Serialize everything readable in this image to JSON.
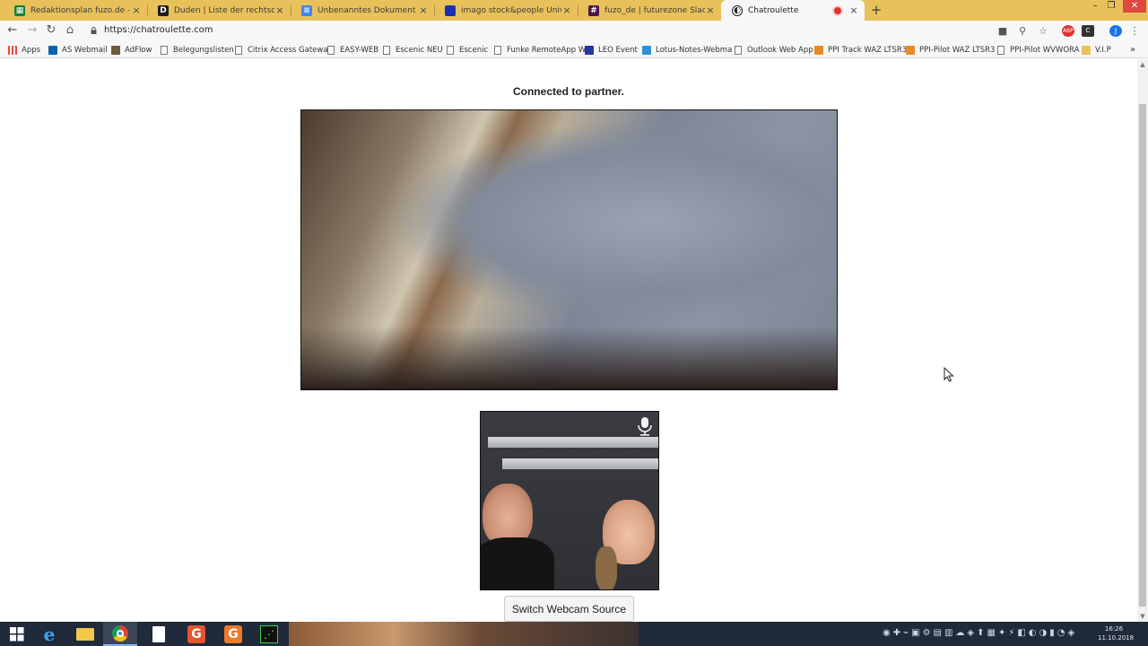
{
  "browser": {
    "tabs": [
      {
        "title": "Redaktionsplan fuzo.de - Google",
        "favicon": "sheets-icon",
        "color": "#188038"
      },
      {
        "title": "Duden | Liste der rechtschreiblich",
        "favicon": "duden-icon",
        "color": "#1b1b1b",
        "glyph": "D"
      },
      {
        "title": "Unbenanntes Dokument - Google",
        "favicon": "docs-icon",
        "color": "#4285f4"
      },
      {
        "title": "imago stock&people Universalfo",
        "favicon": "imago-icon",
        "color": "#1a2fb5"
      },
      {
        "title": "fuzo_de | futurezone Slack",
        "favicon": "slack-icon",
        "color": "#4a154b",
        "glyph": "#"
      },
      {
        "title": "Chatroulette",
        "favicon": "chatroulette-icon",
        "color": "#222222",
        "active": true,
        "recording": true
      }
    ],
    "url": "https://chatroulette.com",
    "bookmarks": [
      {
        "label": "Apps",
        "icon": "apps-grid-icon",
        "color": "#e8453c"
      },
      {
        "label": "AS Webmail",
        "icon": "outlook-icon",
        "color": "#0a64ad"
      },
      {
        "label": "AdFlow",
        "icon": "adflow-icon",
        "color": "#6b5b3a"
      },
      {
        "label": "Belegungslisten",
        "icon": "page-icon"
      },
      {
        "label": "Citrix Access Gatewa",
        "icon": "page-icon"
      },
      {
        "label": "EASY-WEB",
        "icon": "page-icon"
      },
      {
        "label": "Escenic NEU",
        "icon": "page-icon"
      },
      {
        "label": "Escenic",
        "icon": "page-icon"
      },
      {
        "label": "Funke RemoteApp W",
        "icon": "page-icon"
      },
      {
        "label": "LEO Event",
        "icon": "leo-icon",
        "color": "#2335a8"
      },
      {
        "label": "Lotus-Notes-Webma",
        "icon": "lotus-icon",
        "color": "#2f8fd1"
      },
      {
        "label": "Outlook Web App",
        "icon": "page-icon"
      },
      {
        "label": "PPI Track WAZ LTSR3",
        "icon": "ppi-icon",
        "color": "#e88a28"
      },
      {
        "label": "PPI-Pilot WAZ LTSR3",
        "icon": "ppi-icon",
        "color": "#e88a28"
      },
      {
        "label": "PPI-Pilot WVWORA",
        "icon": "page-icon"
      },
      {
        "label": "V.I.P",
        "icon": "folder-icon",
        "color": "#e8c15a"
      }
    ],
    "bookmarks_more": "»"
  },
  "page": {
    "status": "Connected to partner.",
    "switch_button": "Switch Webcam Source"
  },
  "taskbar": {
    "time": "16:26",
    "date": "11.10.2018"
  }
}
